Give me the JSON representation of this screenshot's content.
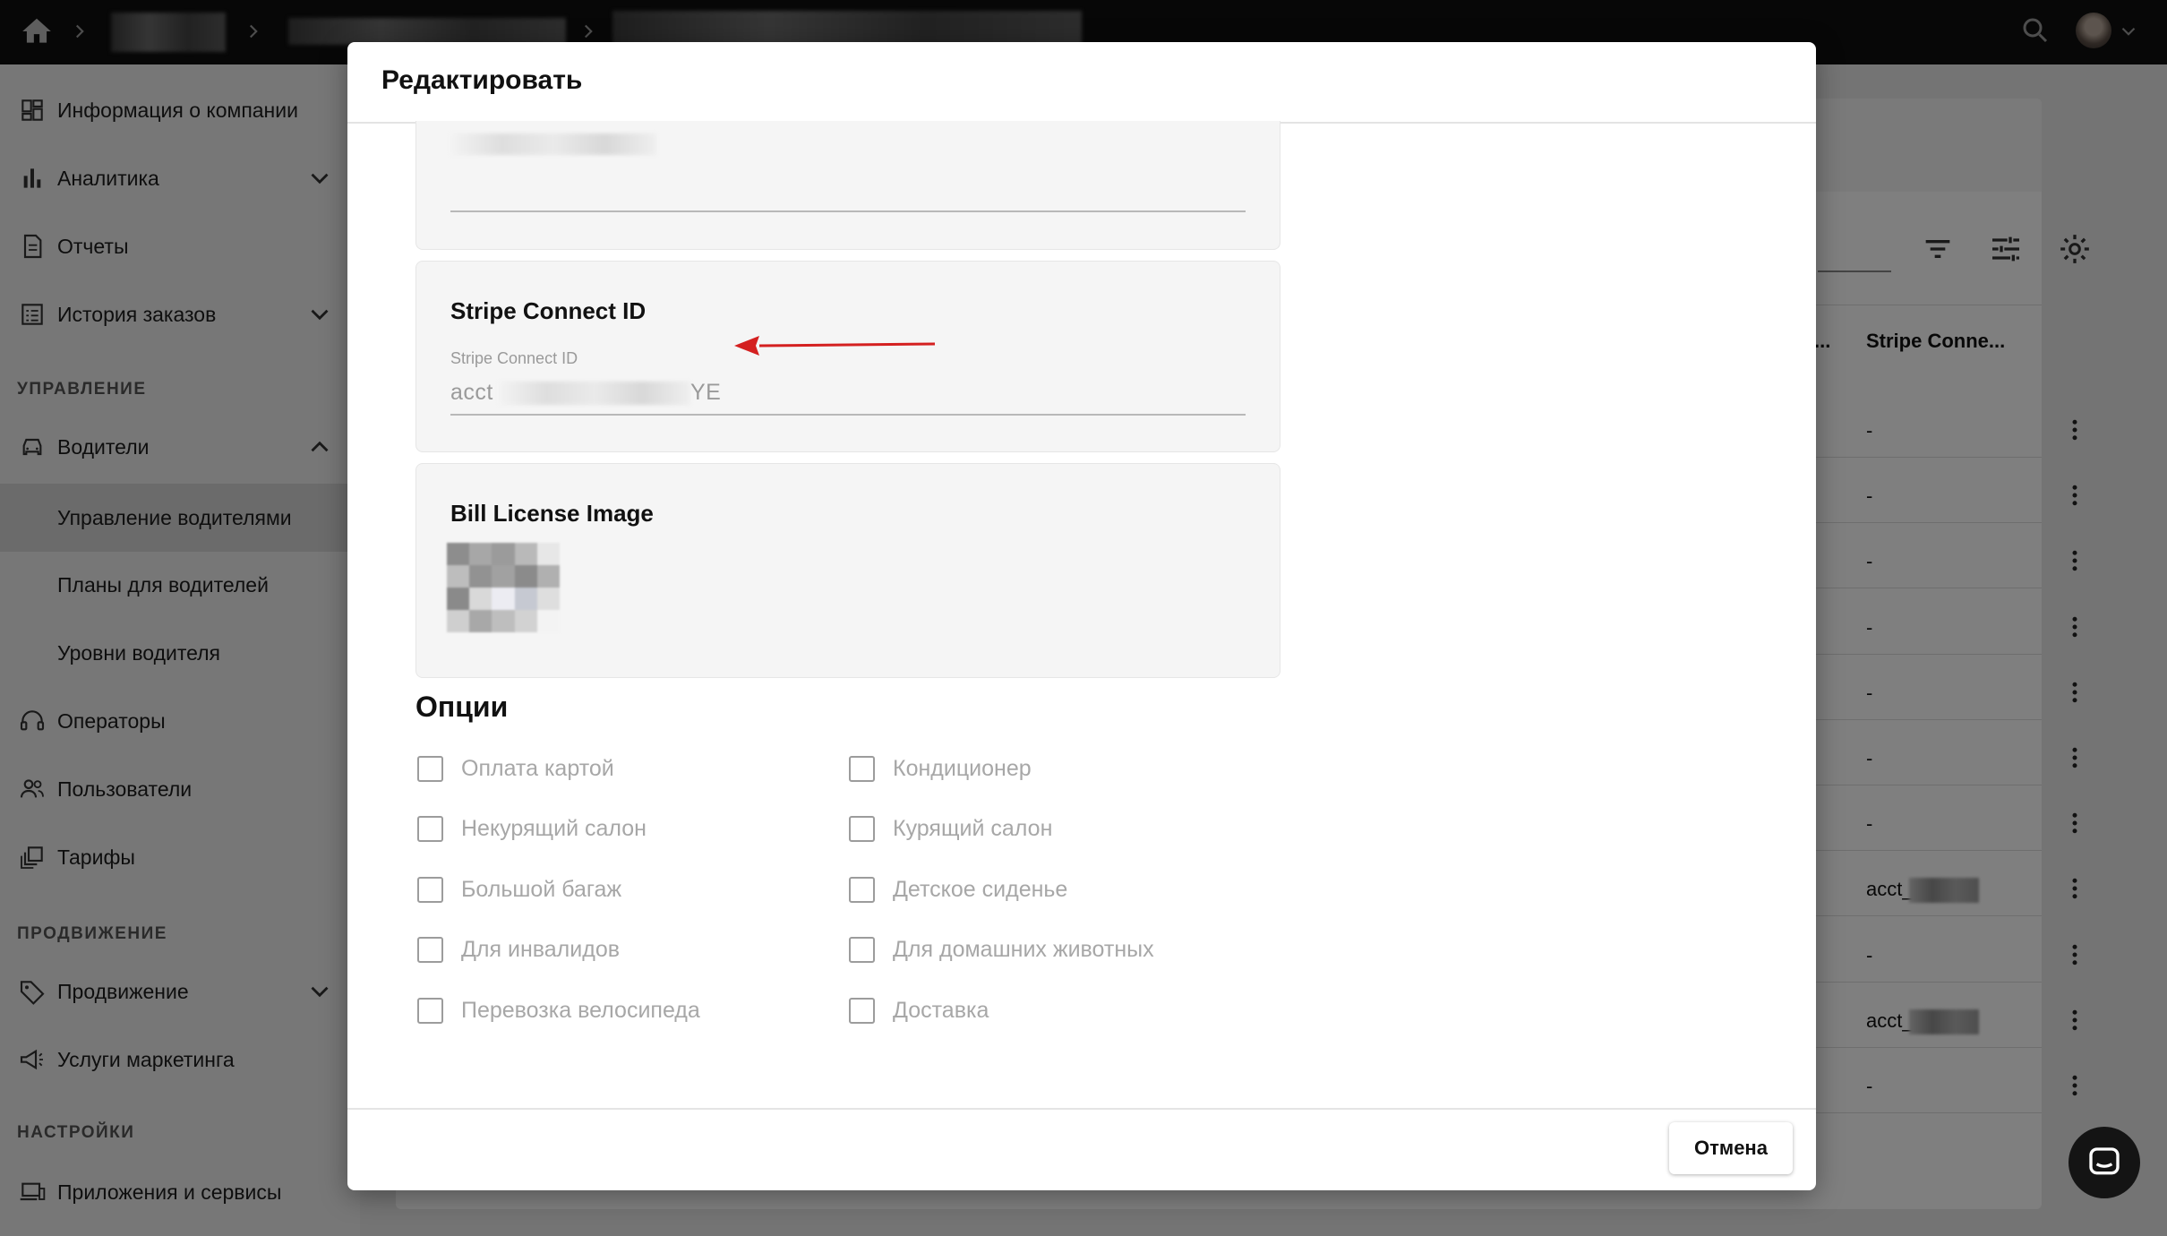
{
  "sidebar": {
    "items": [
      {
        "label": "Информация о компании"
      },
      {
        "label": "Аналитика"
      },
      {
        "label": "Отчеты"
      },
      {
        "label": "История заказов"
      },
      {
        "label": "Водители"
      },
      {
        "label": "Управление водителями"
      },
      {
        "label": "Планы для водителей"
      },
      {
        "label": "Уровни водителя"
      },
      {
        "label": "Операторы"
      },
      {
        "label": "Пользователи"
      },
      {
        "label": "Тарифы"
      },
      {
        "label": "Продвижение"
      },
      {
        "label": "Услуги маркетинга"
      },
      {
        "label": "Приложения и сервисы"
      }
    ],
    "sections": {
      "management": "УПРАВЛЕНИЕ",
      "promotion": "ПРОДВИЖЕНИЕ",
      "settings": "НАСТРОЙКИ"
    }
  },
  "background_table": {
    "column_truncated": "...",
    "column_header": "Stripe Conne...",
    "rows": [
      "-",
      "-",
      "-",
      "-",
      "-",
      "-",
      "-",
      "acct_",
      "-",
      "acct_",
      "-"
    ]
  },
  "modal": {
    "title": "Редактировать",
    "stripe_card": {
      "title": "Stripe Connect ID",
      "field_label": "Stripe Connect ID",
      "value_prefix": "acct",
      "value_suffix": "YE"
    },
    "license_card": {
      "title": "Bill License Image"
    },
    "options": {
      "title": "Опции",
      "left": [
        "Оплата картой",
        "Некурящий салон",
        "Большой багаж",
        "Для инвалидов",
        "Перевозка велосипеда"
      ],
      "right": [
        "Кондиционер",
        "Курящий салон",
        "Детское сиденье",
        "Для домашних животных",
        "Доставка"
      ]
    },
    "cancel_label": "Отмена"
  },
  "colors": {
    "topbar": "#0e0e0e",
    "annotation_arrow": "#d42020",
    "checkbox_border": "#9c9c9c"
  }
}
